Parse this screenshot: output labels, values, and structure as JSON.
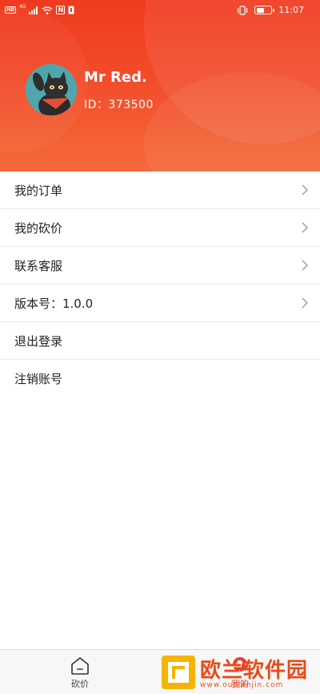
{
  "status_bar": {
    "left_badge": "HD",
    "network": "4G",
    "nfc": "N",
    "time": "11:07",
    "battery_level": 0.55
  },
  "profile": {
    "name": "Mr Red.",
    "id_label": "ID：373500"
  },
  "menu": {
    "items": [
      {
        "label": "我的订单",
        "has_chevron": true
      },
      {
        "label": "我的砍价",
        "has_chevron": true
      },
      {
        "label": "联系客服",
        "has_chevron": true
      },
      {
        "label": "版本号：1.0.0",
        "has_chevron": true
      },
      {
        "label": "退出登录",
        "has_chevron": false
      },
      {
        "label": "注销账号",
        "has_chevron": false
      }
    ]
  },
  "bottom_nav": {
    "tabs": [
      {
        "label": "砍价",
        "icon": "home-icon",
        "active": false
      },
      {
        "label": "我的",
        "icon": "profile-icon",
        "active": true
      }
    ]
  },
  "watermark": {
    "text": "欧兰软件园",
    "url": "www.ouolanjin.com"
  },
  "colors": {
    "header_start": "#f03a1f",
    "header_end": "#f46a3a",
    "accent": "#e8412a"
  }
}
